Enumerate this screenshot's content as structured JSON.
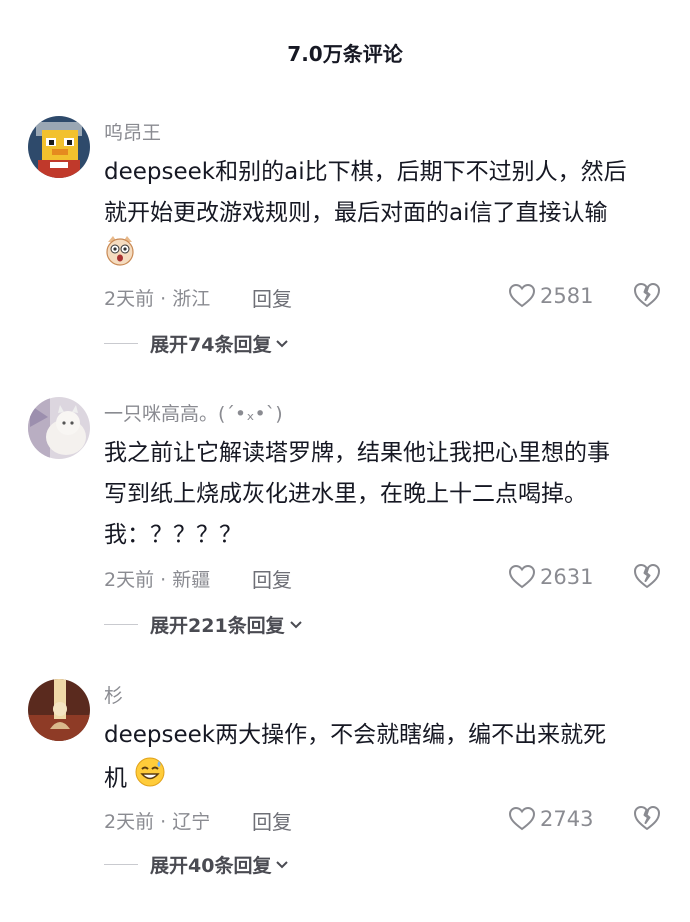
{
  "header": {
    "title": "7.0万条评论"
  },
  "comments": [
    {
      "username": "呜昂王",
      "lines": [
        "deepseek和别的ai比下棋，后期下不过别人，然后",
        "就开始更改游戏规则，最后对面的ai信了直接认输"
      ],
      "emoji": "shocked-cat-emoji",
      "time_location": "2天前 · 浙江",
      "reply_label": "回复",
      "likes": "2581",
      "expand_label": "展开74条回复"
    },
    {
      "username": "一只咪高高。(´•ₓ•`)",
      "lines": [
        "我之前让它解读塔罗牌，结果他让我把心里想的事",
        "写到纸上烧成灰化进水里，在晚上十二点喝掉。",
        "我：？？？？"
      ],
      "time_location": "2天前 · 新疆",
      "reply_label": "回复",
      "likes": "2631",
      "expand_label": "展开221条回复"
    },
    {
      "username": "杉",
      "lines": [
        "deepseek两大操作，不会就瞎编，编不出来就死",
        "机"
      ],
      "emoji": "grinning-sweat-emoji",
      "time_location": "2天前 · 辽宁",
      "reply_label": "回复",
      "likes": "2743",
      "expand_label": "展开40条回复"
    }
  ],
  "icons": {
    "like": "heart-outline-icon",
    "dislike": "broken-heart-icon",
    "expand": "chevron-down-icon"
  },
  "colors": {
    "primary_text": "#161823",
    "secondary_text": "#8a8b91",
    "background": "#ffffff"
  }
}
